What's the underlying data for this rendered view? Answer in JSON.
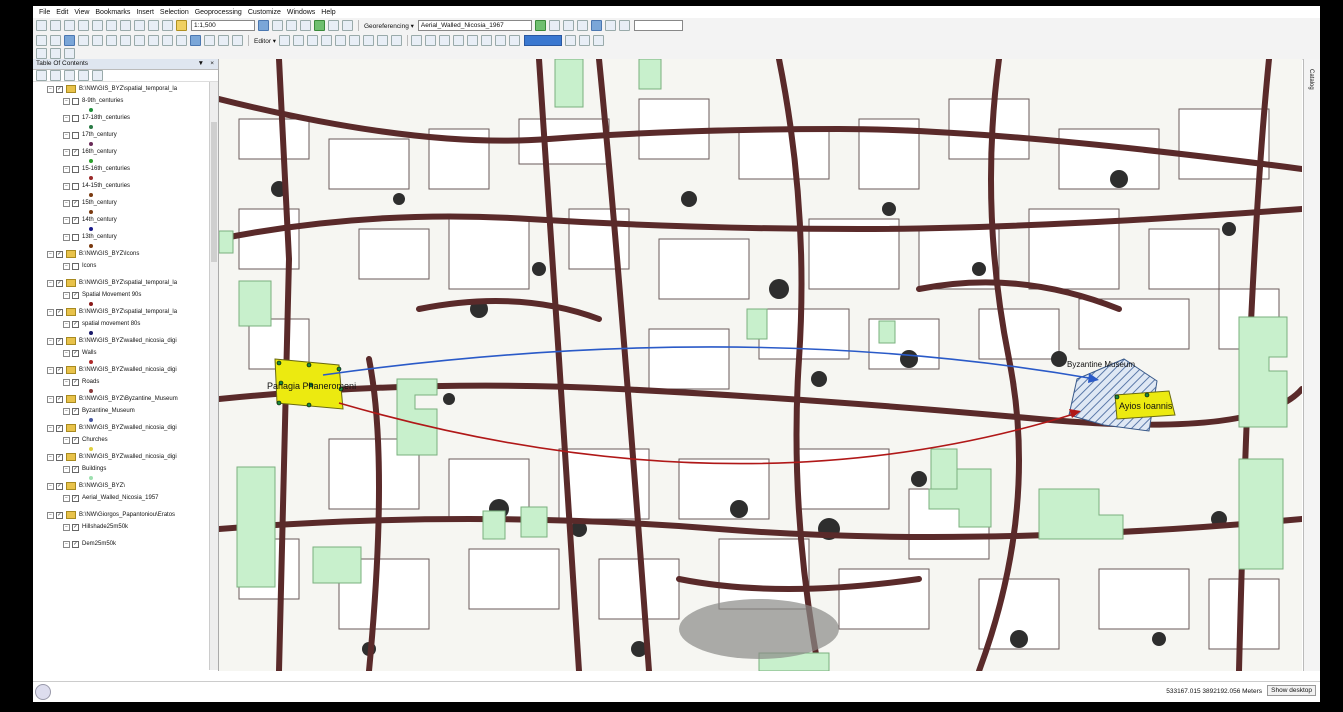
{
  "menu": [
    "File",
    "Edit",
    "View",
    "Bookmarks",
    "Insert",
    "Selection",
    "Geoprocessing",
    "Customize",
    "Windows",
    "Help"
  ],
  "toolbar": {
    "scale": "1:1,500",
    "georef_label": "Georeferencing ▾",
    "georef_layer": "Aerial_Walled_Nicosia_1967",
    "editor_label": "Editor ▾"
  },
  "toc": {
    "title": "Table Of Contents",
    "rows": [
      {
        "kind": "group",
        "text": "B:\\NW\\GIS_BYZ\\spatial_temporal_la"
      },
      {
        "kind": "layer",
        "text": "8-9th_centuries",
        "checked": false,
        "sym": "#1f8f3a"
      },
      {
        "kind": "layer",
        "text": "17-18th_centuries",
        "checked": false,
        "sym": "#2a7a46"
      },
      {
        "kind": "layer",
        "text": "17th_century",
        "checked": false,
        "sym": "#6a2a58"
      },
      {
        "kind": "layer",
        "text": "16th_century",
        "checked": true,
        "sym": "#2aa02a"
      },
      {
        "kind": "layer",
        "text": "15-16th_centuries",
        "checked": false,
        "sym": "#9a2a2a"
      },
      {
        "kind": "layer",
        "text": "14-15th_centuries",
        "checked": false,
        "sym": "#7a3a10"
      },
      {
        "kind": "layer",
        "text": "15th_century",
        "checked": true,
        "sym": "#7a3a10"
      },
      {
        "kind": "layer",
        "text": "14th_century",
        "checked": true,
        "sym": "#1a1a8a"
      },
      {
        "kind": "layer",
        "text": "13th_century",
        "checked": false,
        "sym": "#7a3a10"
      },
      {
        "kind": "group",
        "text": "B:\\NW\\GIS_BYZ\\Icons"
      },
      {
        "kind": "layer",
        "text": "Icons",
        "checked": false,
        "sym": ""
      },
      {
        "kind": "group",
        "text": "B:\\NW\\GIS_BYZ\\spatial_temporal_la"
      },
      {
        "kind": "layer",
        "text": "Spatial Movement 90s",
        "checked": true,
        "sym": "#8a1a1a"
      },
      {
        "kind": "group",
        "text": "B:\\NW\\GIS_BYZ\\spatial_temporal_la"
      },
      {
        "kind": "layer",
        "text": "spatial movement 80s",
        "checked": true,
        "sym": "#1a1a6a"
      },
      {
        "kind": "group",
        "text": "B:\\NW\\GIS_BYZ\\walled_nicosia_digi"
      },
      {
        "kind": "layer",
        "text": "Walls",
        "checked": true,
        "sym": "#b02a2a"
      },
      {
        "kind": "group",
        "text": "B:\\NW\\GIS_BYZ\\walled_nicosia_digi"
      },
      {
        "kind": "layer",
        "text": "Roads",
        "checked": true,
        "sym": "#8a3a3a"
      },
      {
        "kind": "group",
        "text": "B:\\NW\\GIS_BYZ\\Byzantine_Museum"
      },
      {
        "kind": "layer",
        "text": "Byzantine_Museum",
        "checked": true,
        "sym": "#4a5aa0"
      },
      {
        "kind": "group",
        "text": "B:\\NW\\GIS_BYZ\\walled_nicosia_digi"
      },
      {
        "kind": "layer",
        "text": "Churches",
        "checked": true,
        "sym": "#e0d040"
      },
      {
        "kind": "group",
        "text": "B:\\NW\\GIS_BYZ\\walled_nicosia_digi"
      },
      {
        "kind": "layer",
        "text": "Buildings",
        "checked": true,
        "sym": "#9ee0b0"
      },
      {
        "kind": "group",
        "text": "B:\\NW\\GIS_BYZ\\"
      },
      {
        "kind": "layer",
        "text": "Aerial_Walled_Nicosia_1957",
        "checked": true,
        "sym": ""
      },
      {
        "kind": "group",
        "text": "B:\\NW\\Giorgos_Papantoniou\\Eratos"
      },
      {
        "kind": "layer",
        "text": "Hillshade25m50k",
        "checked": true,
        "sym": ""
      },
      {
        "kind": "layer",
        "text": "Dem25m50k",
        "checked": true,
        "sym": ""
      }
    ]
  },
  "map": {
    "label_west": "Panagia Phaneromeni",
    "label_east_top": "Byzantine Museum",
    "label_east": "Ayios Ioannis",
    "colors": {
      "building": "#c8f0cc",
      "road": "#5a2a2a",
      "church": "#ecea10",
      "blue_line": "#2a5ac8",
      "red_line": "#b01818"
    }
  },
  "right_panel": "Catalog",
  "status": {
    "coords": "533167.015  3892192.056 Meters",
    "show_desktop": "Show desktop"
  }
}
